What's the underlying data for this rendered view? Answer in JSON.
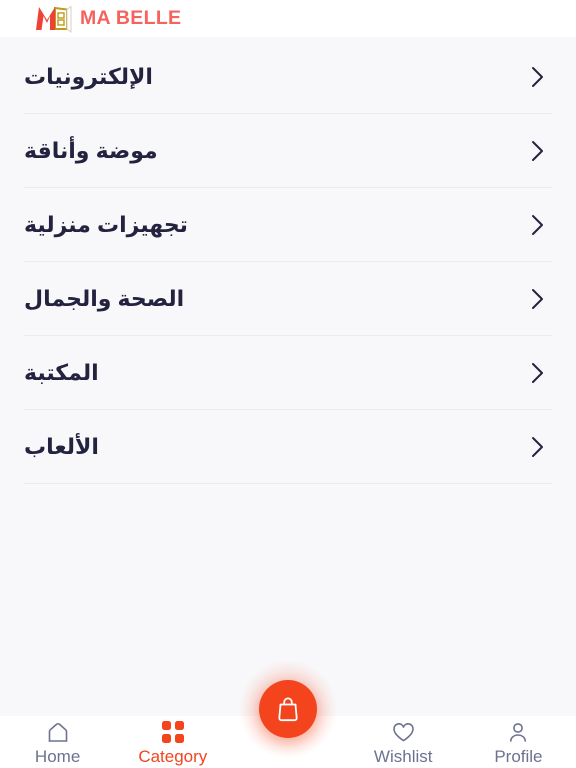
{
  "header": {
    "logo_icon": "ma-belle-monogram-icon",
    "brand_text": "MA BELLE",
    "brand_color": "#f4635e",
    "monogram_m_color": "#ef4136",
    "monogram_b_color": "#c09a16"
  },
  "main": {
    "categories": [
      {
        "label": "الإلكترونيات",
        "chevron_icon": "chevron-right-icon"
      },
      {
        "label": "موضة وأناقة",
        "chevron_icon": "chevron-right-icon"
      },
      {
        "label": "تجهيزات منزلية",
        "chevron_icon": "chevron-right-icon"
      },
      {
        "label": "الصحة والجمال",
        "chevron_icon": "chevron-right-icon"
      },
      {
        "label": "المكتبة",
        "chevron_icon": "chevron-right-icon"
      },
      {
        "label": "الألعاب",
        "chevron_icon": "chevron-right-icon"
      }
    ]
  },
  "bottom_nav": {
    "active_color": "#f4441e",
    "inactive_color": "#6d7290",
    "items": [
      {
        "label": "Home",
        "icon": "home-icon",
        "active": false
      },
      {
        "label": "Category",
        "icon": "grid-icon",
        "active": true
      },
      {
        "label": "Wishlist",
        "icon": "heart-icon",
        "active": false
      },
      {
        "label": "Profile",
        "icon": "person-icon",
        "active": false
      }
    ],
    "fab": {
      "icon": "shopping-bag-icon",
      "color": "#f4441e"
    }
  }
}
